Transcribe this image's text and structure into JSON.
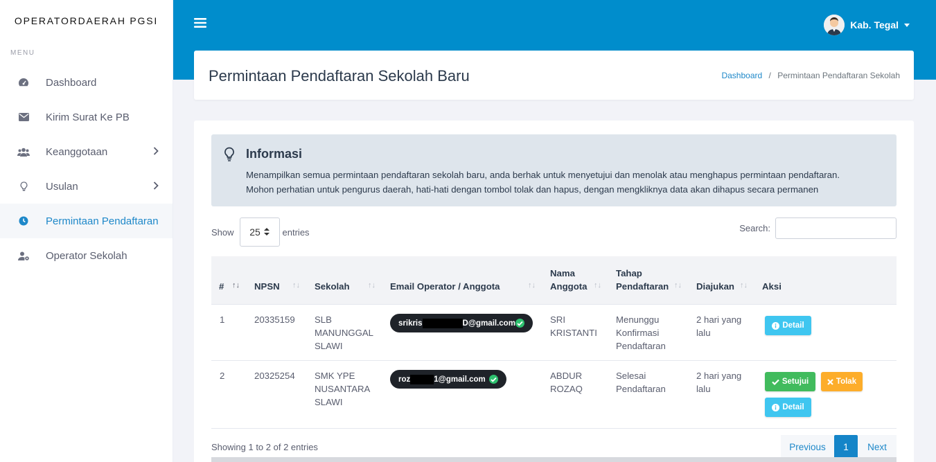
{
  "sidebar": {
    "brand": "OPERATORDAERAH PGSI",
    "menu_label": "MENU",
    "items": [
      {
        "label": "Dashboard",
        "icon": "gauge-icon"
      },
      {
        "label": "Kirim Surat Ke PB",
        "icon": "envelope-icon"
      },
      {
        "label": "Keanggotaan",
        "icon": "users-icon"
      },
      {
        "label": "Usulan",
        "icon": "lightbulb-icon"
      },
      {
        "label": "Permintaan Pendaftaran",
        "icon": "clock-icon"
      },
      {
        "label": "Operator Sekolah",
        "icon": "user-gear-icon"
      }
    ]
  },
  "header": {
    "user_name": "Kab. Tegal",
    "accent_color": "#008dcc"
  },
  "page": {
    "title": "Permintaan Pendaftaran Sekolah Baru",
    "breadcrumb": {
      "home": "Dashboard",
      "separator": "/",
      "current": "Permintaan Pendaftaran Sekolah"
    }
  },
  "info": {
    "title": "Informasi",
    "line1": "Menampilkan semua permintaan pendaftaran sekolah baru, anda berhak untuk menyetujui dan menolak atau menghapus permintaan pendaftaran.",
    "line2": "Mohon perhatian untuk pengurus daerah, hati-hati dengan tombol tolak dan hapus, dengan mengkliknya data akan dihapus secara permanen"
  },
  "table_controls": {
    "show_label": "Show",
    "entries_value": "25",
    "entries_label": "entries",
    "search_label": "Search:",
    "search_value": ""
  },
  "table": {
    "headers": {
      "num": "#",
      "npsn": "NPSN",
      "sekolah": "Sekolah",
      "email": "Email Operator / Anggota",
      "nama_l1": "Nama",
      "nama_l2": "Anggota",
      "tahap_l1": "Tahap",
      "tahap_l2": "Pendaftaran",
      "diajukan": "Diajukan",
      "aksi": "Aksi"
    },
    "rows": [
      {
        "num": "1",
        "npsn": "20335159",
        "sekolah_l1": "SLB",
        "sekolah_l2": "MANUNGGAL",
        "sekolah_l3": "SLAWI",
        "email_pre": "srikris",
        "email_post": "D@gmail.com",
        "nama_l1": "SRI",
        "nama_l2": "KRISTANTI",
        "tahap_l1": "Menunggu",
        "tahap_l2": "Konfirmasi",
        "tahap_l3": "Pendaftaran",
        "diajukan_l1": "2 hari yang",
        "diajukan_l2": "lalu",
        "detail_label": "Detail"
      },
      {
        "num": "2",
        "npsn": "20325254",
        "sekolah_l1": "SMK YPE",
        "sekolah_l2": "NUSANTARA",
        "sekolah_l3": "SLAWI",
        "email_pre": "roz",
        "email_post": "1@gmail.com",
        "nama_l1": "ABDUR",
        "nama_l2": "ROZAQ",
        "tahap_l1": "Selesai",
        "tahap_l2": "Pendaftaran",
        "diajukan_l1": "2 hari yang",
        "diajukan_l2": "lalu",
        "setujui_label": "Setujui",
        "tolak_label": "Tolak",
        "detail_label": "Detail"
      }
    ]
  },
  "footer": {
    "showing": "Showing 1 to 2 of 2 entries",
    "previous": "Previous",
    "page": "1",
    "next": "Next"
  }
}
